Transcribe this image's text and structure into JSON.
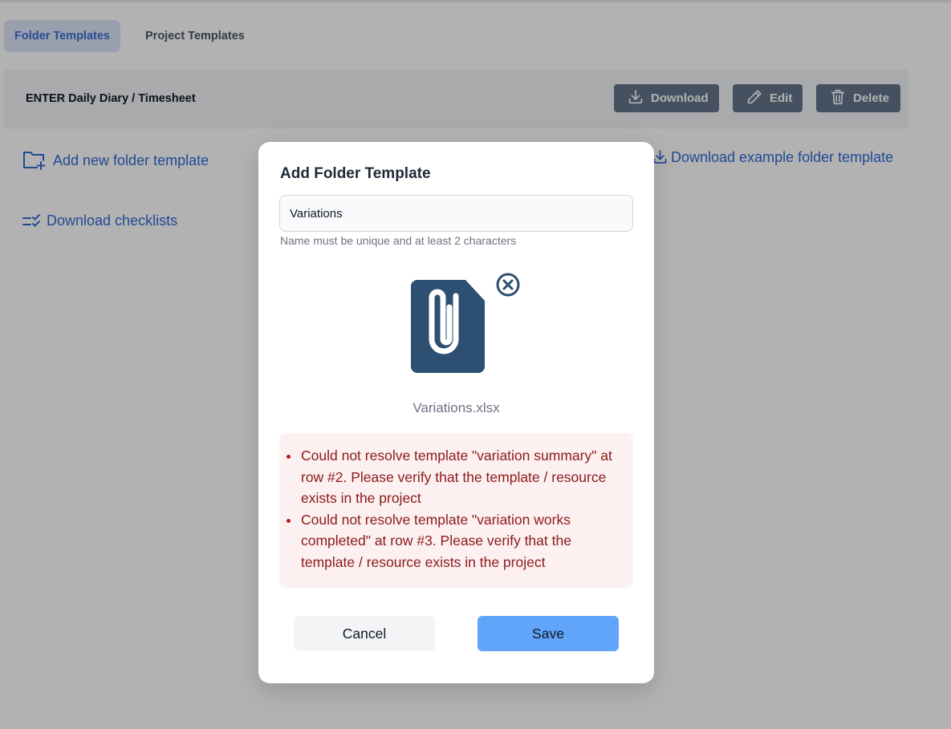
{
  "tabs": [
    {
      "label": "Folder Templates",
      "active": true
    },
    {
      "label": "Project Templates",
      "active": false
    }
  ],
  "template_row": {
    "name": "ENTER Daily Diary / Timesheet",
    "download_label": "Download",
    "edit_label": "Edit",
    "delete_label": "Delete"
  },
  "links": {
    "add_folder": "Add new folder template",
    "download_checklists": "Download checklists",
    "download_example": "Download example folder template"
  },
  "modal": {
    "title": "Add Folder Template",
    "name_value": "Variations",
    "helper_text": "Name must be unique and at least 2 characters",
    "file_name": "Variations.xlsx",
    "errors": [
      "Could not resolve template \"variation summary\" at row #2. Please verify that the template / resource exists in the project",
      "Could not resolve template \"variation works completed\" at row #3. Please verify that the template / resource exists in the project"
    ],
    "cancel_label": "Cancel",
    "save_label": "Save"
  },
  "colors": {
    "accent": "#2f6bd6",
    "action_button": "#64748b",
    "save_button": "#60a5fa",
    "error_text": "#8b1a1a",
    "error_bg": "#fdf0f0",
    "file_icon": "#2d4f72"
  },
  "icons": {
    "download": "download-icon",
    "edit": "pencil-icon",
    "delete": "trash-icon",
    "add_folder": "folder-plus-icon",
    "checklists": "checklist-icon",
    "file": "paperclip-file-icon",
    "remove": "close-circle-icon"
  }
}
